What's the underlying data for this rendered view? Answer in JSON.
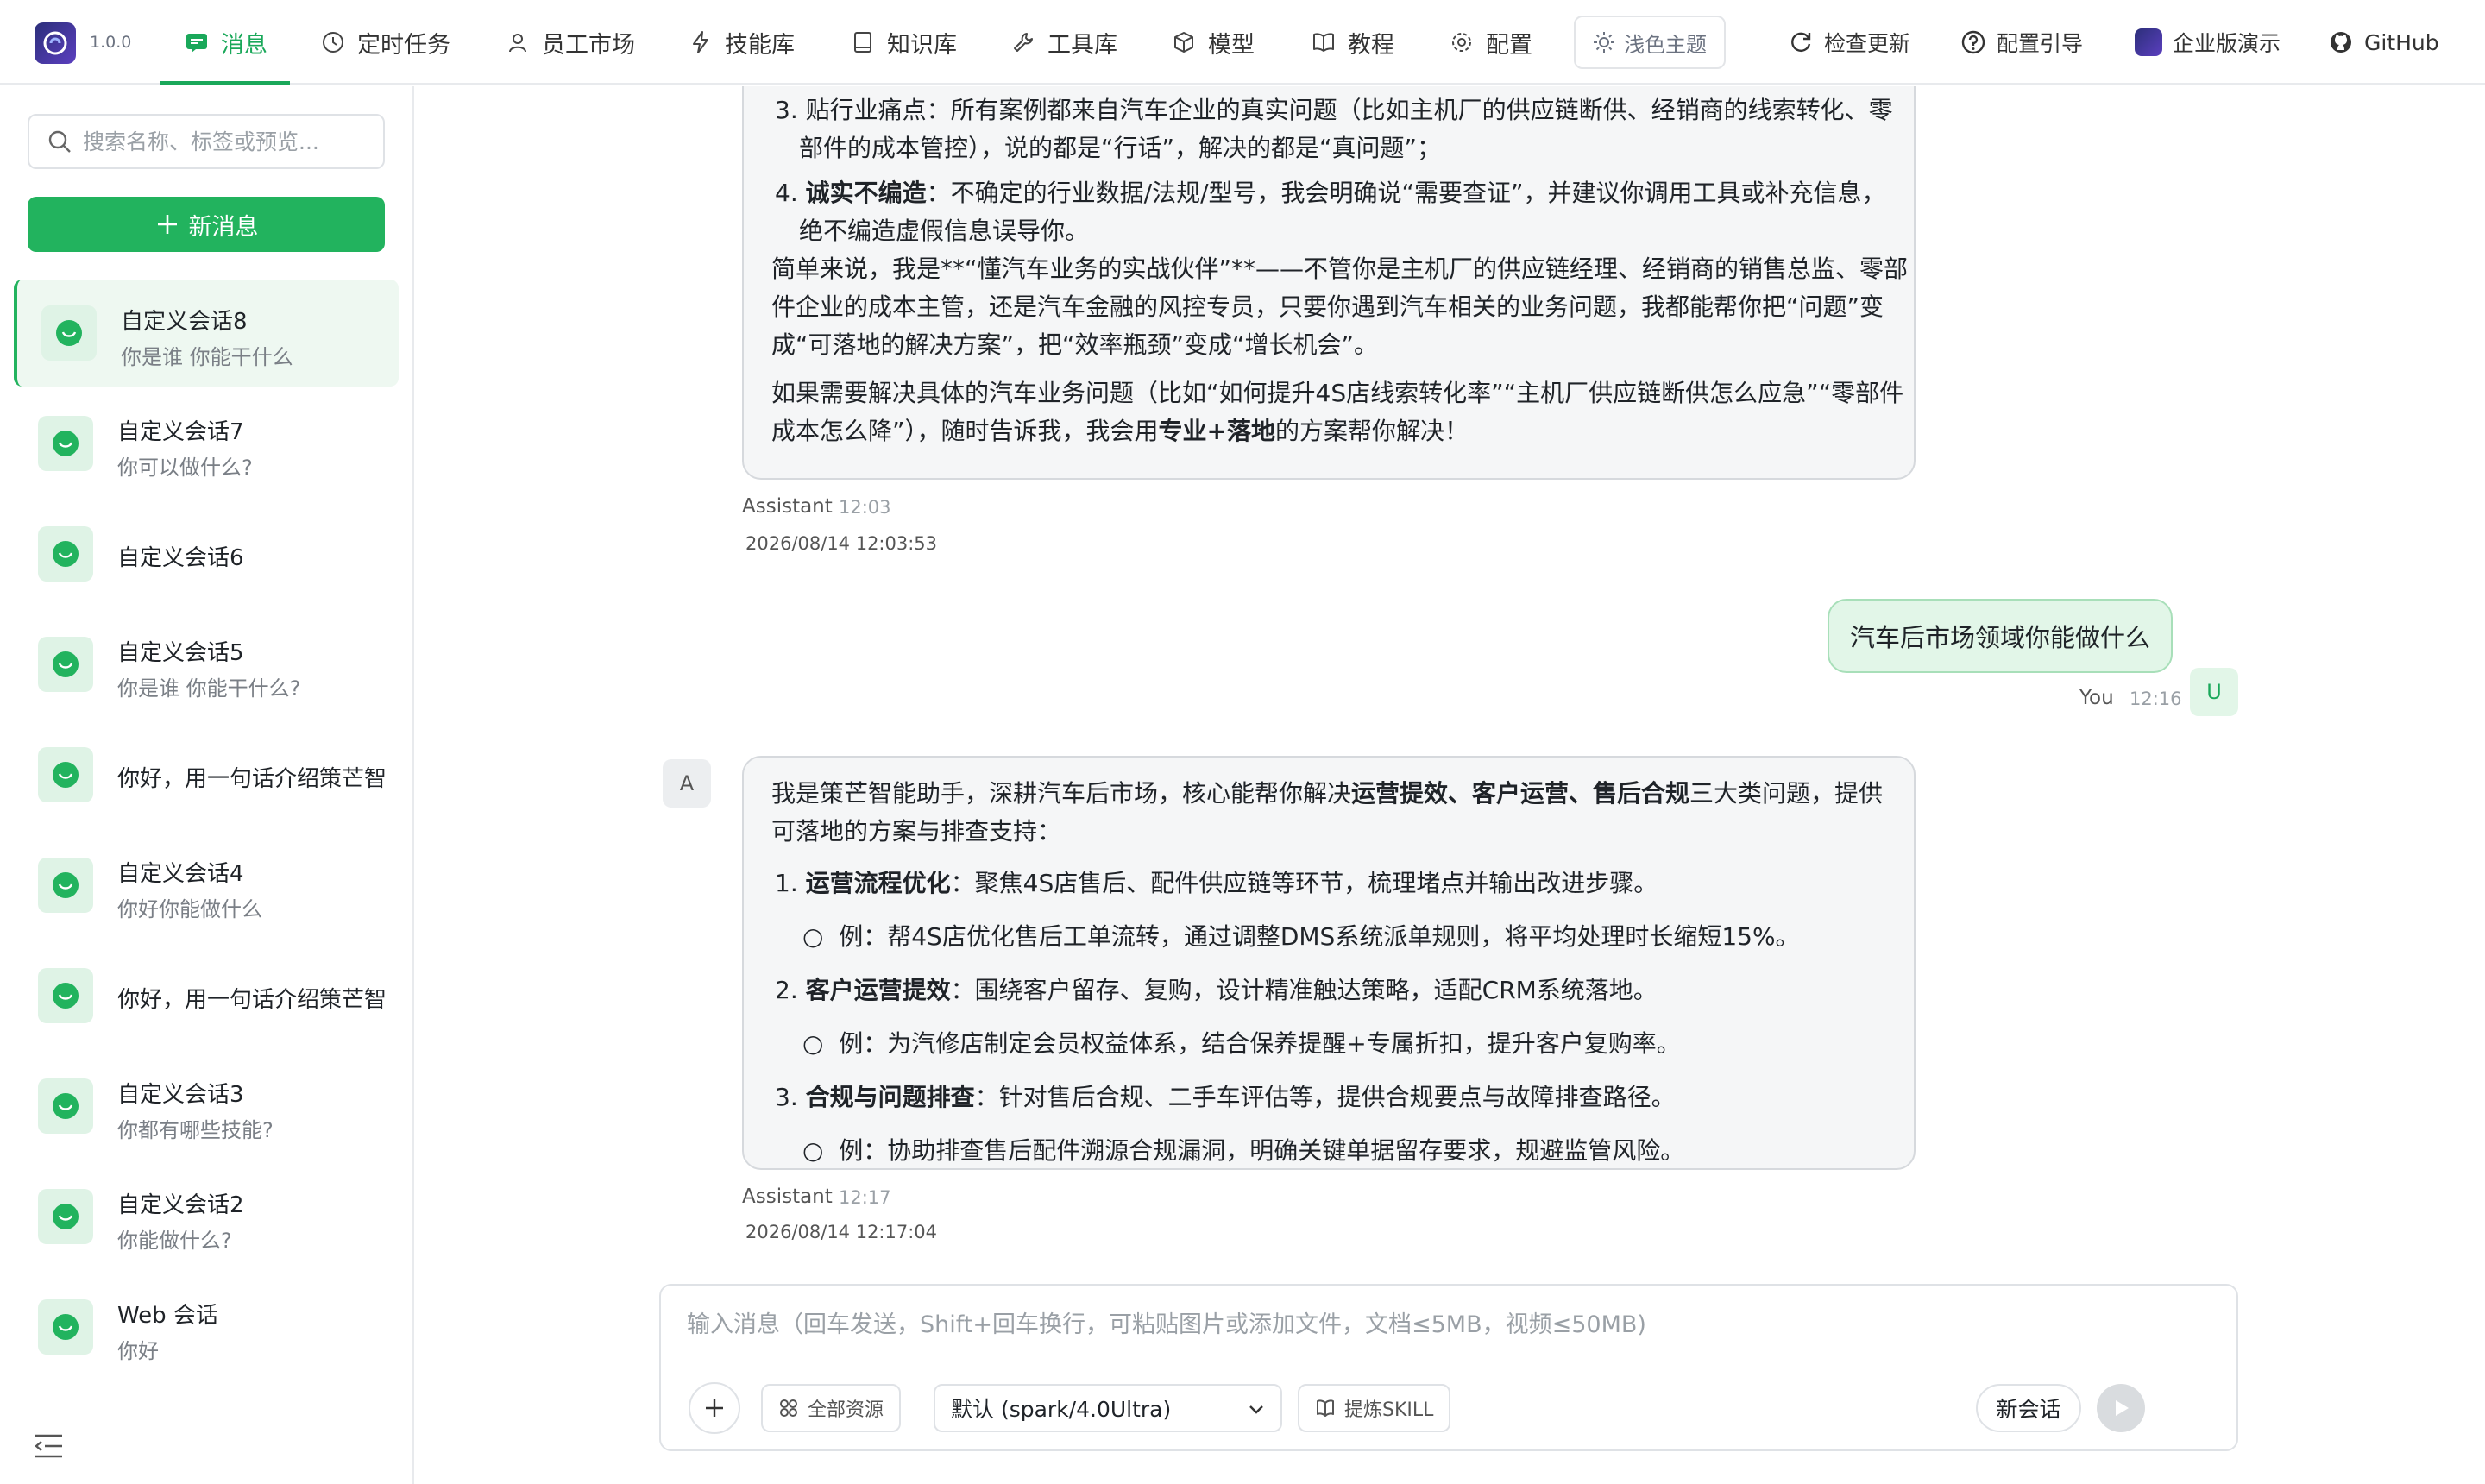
{
  "app": {
    "version": "1.0.0",
    "colors": {
      "accent": "#22b35e",
      "accent_text": "#1aa85a",
      "bubble_bg": "#f5f6f7",
      "user_bubble_bg": "#e2f6e8"
    }
  },
  "nav": {
    "items": [
      {
        "label": "消息",
        "icon": "message-icon",
        "active": true
      },
      {
        "label": "定时任务",
        "icon": "clock-icon"
      },
      {
        "label": "员工市场",
        "icon": "user-icon"
      },
      {
        "label": "技能库",
        "icon": "lightning-icon"
      },
      {
        "label": "知识库",
        "icon": "book-icon"
      },
      {
        "label": "工具库",
        "icon": "wrench-icon"
      },
      {
        "label": "模型",
        "icon": "cube-icon"
      },
      {
        "label": "教程",
        "icon": "open-book-icon"
      },
      {
        "label": "配置",
        "icon": "gear-icon"
      }
    ],
    "theme_label": "浅色主题",
    "right": {
      "check_update": "检查更新",
      "config_guide": "配置引导",
      "enterprise_demo": "企业版演示",
      "github": "GitHub"
    }
  },
  "sidebar": {
    "search_placeholder": "搜索名称、标签或预览...",
    "new_message_label": "新消息",
    "conversations": [
      {
        "title": "自定义会话8",
        "subtitle": "你是谁 你能干什么"
      },
      {
        "title": "自定义会话7",
        "subtitle": "你可以做什么?"
      },
      {
        "title": "自定义会话6",
        "subtitle": ""
      },
      {
        "title": "自定义会话5",
        "subtitle": "你是谁 你能干什么?"
      },
      {
        "title": "你好，用一句话介绍策芒智",
        "subtitle": ""
      },
      {
        "title": "自定义会话4",
        "subtitle": "你好你能做什么"
      },
      {
        "title": "你好，用一句话介绍策芒智",
        "subtitle": ""
      },
      {
        "title": "自定义会话3",
        "subtitle": "你都有哪些技能?"
      },
      {
        "title": "自定义会话2",
        "subtitle": "你能做什么?"
      },
      {
        "title": "Web 会话",
        "subtitle": "你好"
      }
    ]
  },
  "chat": {
    "msg1": {
      "l1": "3. 贴行业痛点：所有案例都来自汽车企业的真实问题（比如主机厂的供应链断供、经销商的线索转化、零",
      "l2": "部件的成本管控），说的都是“行话”，解决的都是“真问题”；",
      "l3_num": "4.",
      "l3_bold": "诚实不编造",
      "l3_rest": "：不确定的行业数据/法规/型号，我会明确说“需要查证”，并建议你调用工具或补充信息，",
      "l4": "绝不编造虚假信息误导你。",
      "l5": "简单来说，我是**“懂汽车业务的实战伙伴”**——不管你是主机厂的供应链经理、经销商的销售总监、零部",
      "l6": "件企业的成本主管，还是汽车金融的风控专员，只要你遇到汽车相关的业务问题，我都能帮你把“问题”变",
      "l7": "成“可落地的解决方案”，把“效率瓶颈”变成“增长机会”。",
      "l8": "如果需要解决具体的汽车业务问题（比如“如何提升4S店线索转化率”“主机厂供应链断供怎么应急”“零部件",
      "l9_a": "成本怎么降”），随时告诉我，我会用",
      "l9_bold": "专业+落地",
      "l9_b": "的方案帮你解决！",
      "sender": "Assistant",
      "time": "12:03",
      "date": "2026/08/14 12:03:53"
    },
    "user_msg": {
      "text": "汽车后市场领域你能做什么",
      "sender": "You",
      "time": "12:16",
      "avatar": "U"
    },
    "msg2": {
      "avatar": "A",
      "intro_a": "我是策芒智能助手，深耕汽车后市场，核心能帮你解决",
      "intro_bold": "运营提效、客户运营、售后合规",
      "intro_b": "三大类问题，提供",
      "intro_c": "可落地的方案与排查支持：",
      "items": [
        {
          "num": "1.",
          "bold": "运营流程优化",
          "rest": "：聚焦4S店售后、配件供应链等环节，梳理堵点并输出改进步骤。",
          "example": "例：帮4S店优化售后工单流转，通过调整DMS系统派单规则，将平均处理时长缩短15%。"
        },
        {
          "num": "2.",
          "bold": "客户运营提效",
          "rest": "：围绕客户留存、复购，设计精准触达策略，适配CRM系统落地。",
          "example": "例：为汽修店制定会员权益体系，结合保养提醒+专属折扣，提升客户复购率。"
        },
        {
          "num": "3.",
          "bold": "合规与问题排查",
          "rest": "：针对售后合规、二手车评估等，提供合规要点与故障排查路径。",
          "example": "例：协助排查售后配件溯源合规漏洞，明确关键单据留存要求，规避监管风险。"
        }
      ],
      "sender": "Assistant",
      "time": "12:17",
      "date": "2026/08/14 12:17:04"
    }
  },
  "composer": {
    "placeholder": "输入消息（回车发送，Shift+回车换行，可粘贴图片或添加文件，文档≤5MB，视频≤50MB)",
    "all_resources": "全部资源",
    "model": "默认 (spark/4.0Ultra)",
    "extract_skill": "提炼SKILL",
    "new_conversation": "新会话"
  }
}
